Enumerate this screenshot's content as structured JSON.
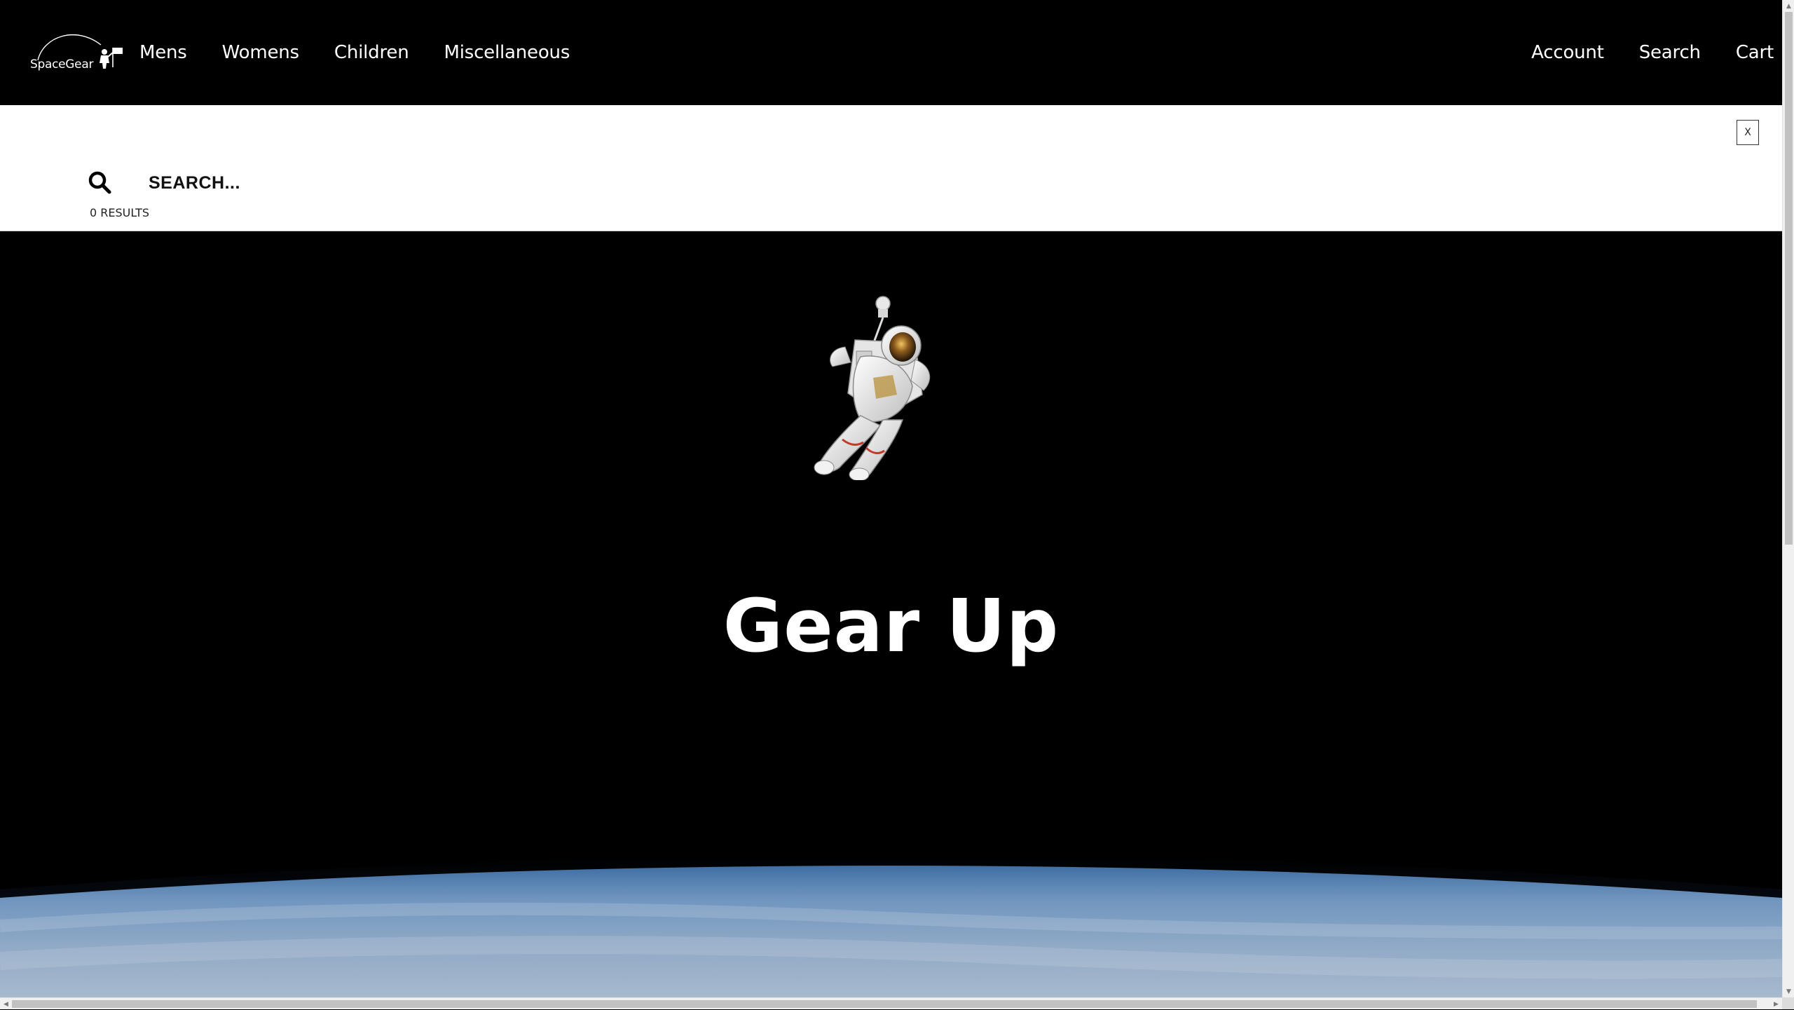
{
  "header": {
    "logo_text": "SpaceGear",
    "nav_left": [
      {
        "label": "Mens"
      },
      {
        "label": "Womens"
      },
      {
        "label": "Children"
      },
      {
        "label": "Miscellaneous"
      }
    ],
    "nav_right": [
      {
        "label": "Account"
      },
      {
        "label": "Search"
      },
      {
        "label": "Cart"
      }
    ]
  },
  "search": {
    "placeholder": "SEARCH...",
    "value": "",
    "results_count": "0 RESULTS",
    "close_label": "X"
  },
  "hero": {
    "title": "Gear Up"
  },
  "icons": {
    "search": "search-icon",
    "close": "close-icon"
  },
  "colors": {
    "header_bg": "#000000",
    "search_panel_bg": "#ffffff",
    "hero_bg": "#000000",
    "text_light": "#ffffff",
    "text_dark": "#111111"
  }
}
